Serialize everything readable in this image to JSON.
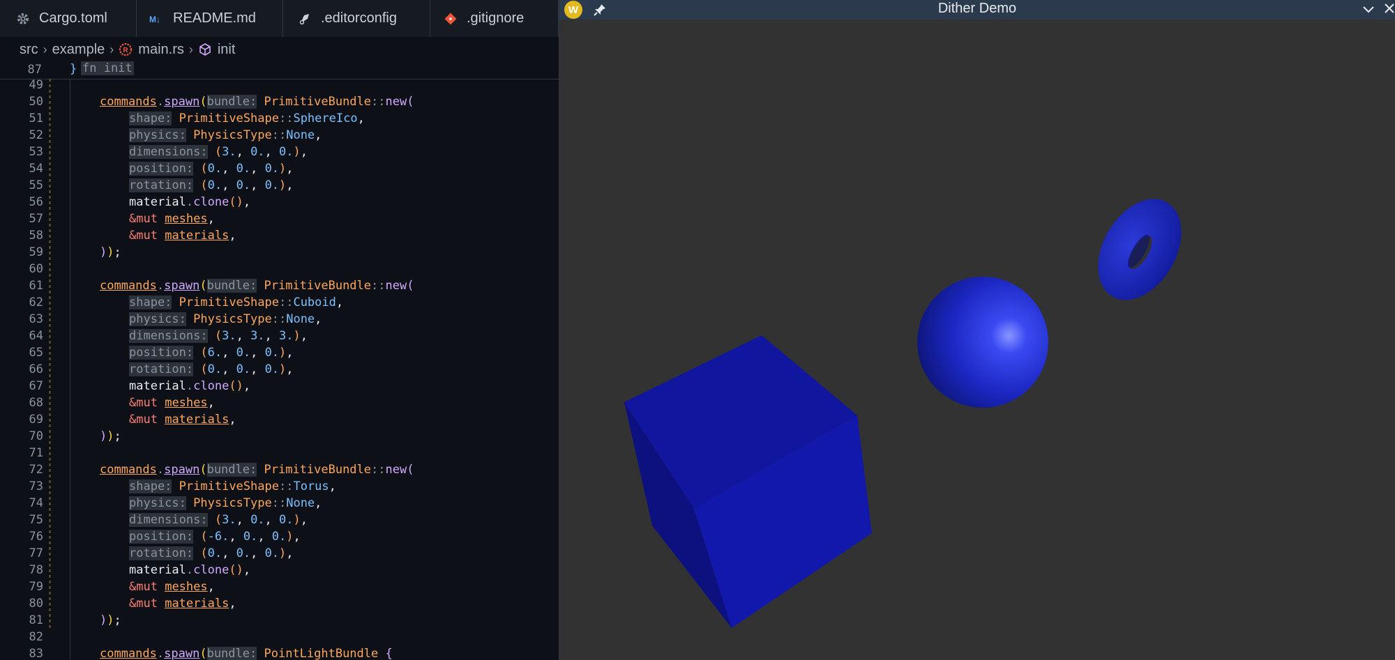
{
  "editor": {
    "tabs": [
      {
        "icon": "gear-icon",
        "label": "Cargo.toml",
        "width": 196
      },
      {
        "icon": "markdown-icon",
        "label": "README.md",
        "width": 210
      },
      {
        "icon": "editorconfig-icon",
        "label": ".editorconfig",
        "width": 211
      },
      {
        "icon": "git-icon",
        "label": ".gitignore",
        "width": 184
      }
    ],
    "breadcrumb": {
      "src": "src",
      "example": "example",
      "file": "main.rs",
      "symbol": "init"
    },
    "sticky": {
      "line": "87",
      "brace": "}",
      "text": "fn init"
    }
  },
  "demo_window": {
    "title": "Dither Demo",
    "app_icon_letter": "W"
  }
}
